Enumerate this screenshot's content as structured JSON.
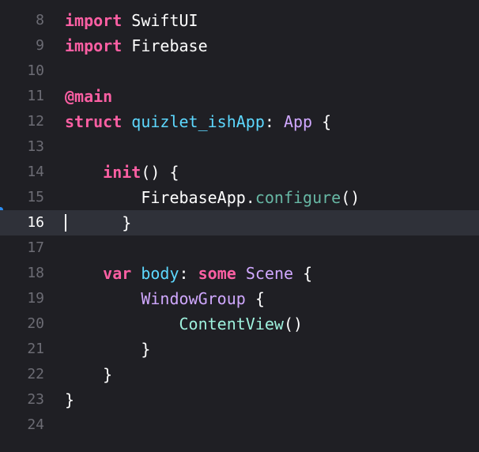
{
  "editor": {
    "language": "Swift",
    "current_line": "16",
    "lines": [
      {
        "num": "8",
        "tokens": [
          [
            "kw",
            "import"
          ],
          [
            "plain",
            " SwiftUI"
          ]
        ]
      },
      {
        "num": "9",
        "tokens": [
          [
            "kw",
            "import"
          ],
          [
            "plain",
            " Firebase"
          ]
        ]
      },
      {
        "num": "10",
        "tokens": []
      },
      {
        "num": "11",
        "tokens": [
          [
            "kw",
            "@main"
          ]
        ]
      },
      {
        "num": "12",
        "tokens": [
          [
            "kw",
            "struct"
          ],
          [
            "plain",
            " "
          ],
          [
            "prop",
            "quizlet_ishApp"
          ],
          [
            "plain",
            ": "
          ],
          [
            "ty",
            "App"
          ],
          [
            "plain",
            " {"
          ]
        ]
      },
      {
        "num": "13",
        "tokens": []
      },
      {
        "num": "14",
        "tokens": [
          [
            "plain",
            "    "
          ],
          [
            "kw",
            "init"
          ],
          [
            "plain",
            "() {"
          ]
        ]
      },
      {
        "num": "15",
        "tokens": [
          [
            "plain",
            "        FirebaseApp."
          ],
          [
            "fn",
            "configure"
          ],
          [
            "plain",
            "()"
          ]
        ]
      },
      {
        "num": "16",
        "tokens": [
          [
            "plain",
            "      }"
          ]
        ]
      },
      {
        "num": "17",
        "tokens": []
      },
      {
        "num": "18",
        "tokens": [
          [
            "plain",
            "    "
          ],
          [
            "kw",
            "var"
          ],
          [
            "plain",
            " "
          ],
          [
            "prop",
            "body"
          ],
          [
            "plain",
            ": "
          ],
          [
            "kw",
            "some"
          ],
          [
            "plain",
            " "
          ],
          [
            "ty",
            "Scene"
          ],
          [
            "plain",
            " {"
          ]
        ]
      },
      {
        "num": "19",
        "tokens": [
          [
            "plain",
            "        "
          ],
          [
            "ty",
            "WindowGroup"
          ],
          [
            "plain",
            " {"
          ]
        ]
      },
      {
        "num": "20",
        "tokens": [
          [
            "plain",
            "            "
          ],
          [
            "tyb",
            "ContentView"
          ],
          [
            "plain",
            "()"
          ]
        ]
      },
      {
        "num": "21",
        "tokens": [
          [
            "plain",
            "        }"
          ]
        ]
      },
      {
        "num": "22",
        "tokens": [
          [
            "plain",
            "    }"
          ]
        ]
      },
      {
        "num": "23",
        "tokens": [
          [
            "plain",
            "}"
          ]
        ]
      },
      {
        "num": "24",
        "tokens": []
      }
    ]
  },
  "colors": {
    "background": "#1f1f24",
    "current_line_highlight": "#2f3139",
    "keyword": "#fc5fa3",
    "type": "#d0a8ff",
    "type_declared": "#9ef1dd",
    "function": "#67b7a4",
    "property": "#5dd8ff",
    "gutter": "#6c6c74",
    "breakpoint_indicator": "#2b8cf2"
  }
}
